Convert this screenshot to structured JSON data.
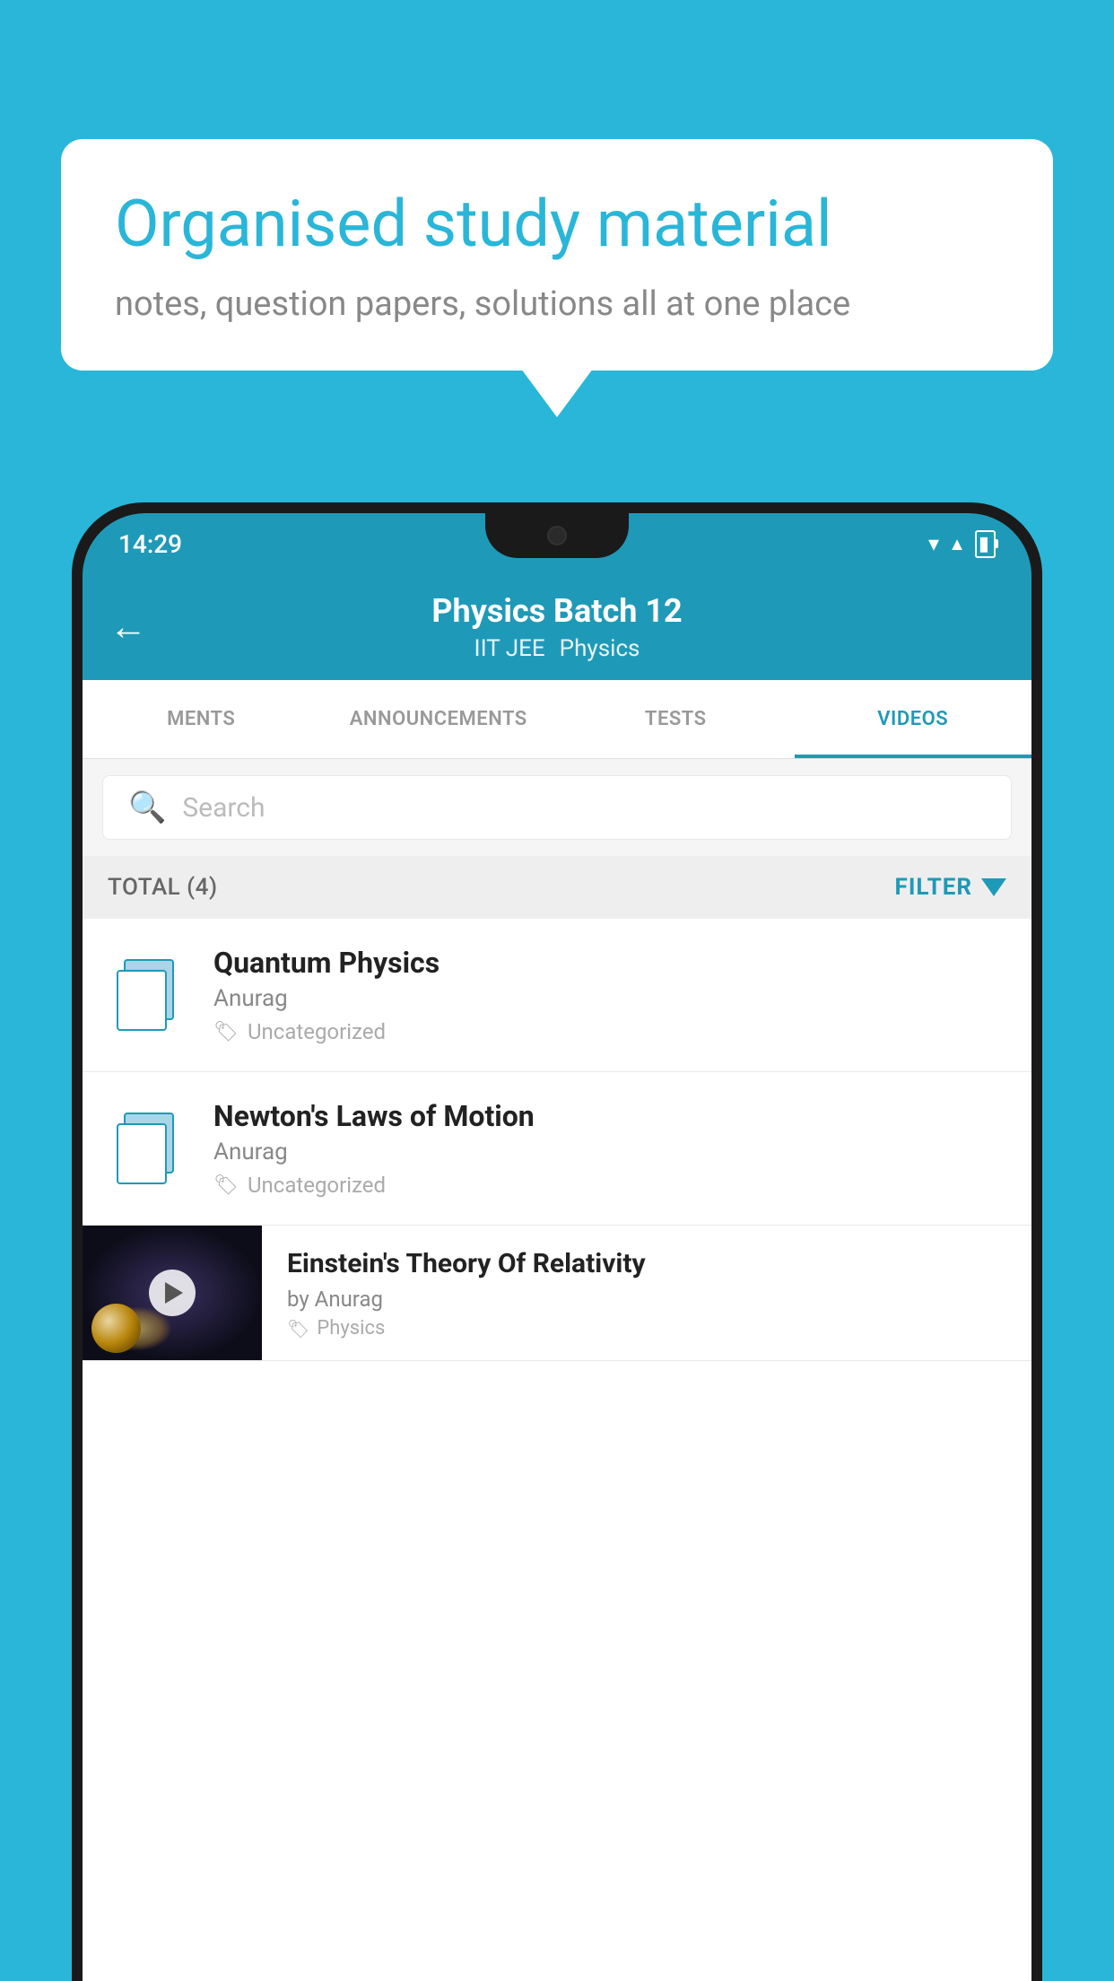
{
  "background_color": "#29b6d8",
  "bubble": {
    "title": "Organised study material",
    "subtitle": "notes, question papers, solutions all at one place"
  },
  "status_bar": {
    "time": "14:29",
    "icons": [
      "wifi",
      "signal",
      "battery"
    ]
  },
  "header": {
    "title": "Physics Batch 12",
    "subtitle1": "IIT JEE",
    "subtitle2": "Physics",
    "back_label": "←"
  },
  "tabs": [
    {
      "label": "MENTS",
      "active": false
    },
    {
      "label": "ANNOUNCEMENTS",
      "active": false
    },
    {
      "label": "TESTS",
      "active": false
    },
    {
      "label": "VIDEOS",
      "active": true
    }
  ],
  "search": {
    "placeholder": "Search"
  },
  "filter_bar": {
    "total_label": "TOTAL (4)",
    "filter_label": "FILTER"
  },
  "videos": [
    {
      "title": "Quantum Physics",
      "author": "Anurag",
      "tag": "Uncategorized",
      "has_thumb": false
    },
    {
      "title": "Newton's Laws of Motion",
      "author": "Anurag",
      "tag": "Uncategorized",
      "has_thumb": false
    },
    {
      "title": "Einstein's Theory Of Relativity",
      "author": "by Anurag",
      "tag": "Physics",
      "has_thumb": true
    }
  ]
}
